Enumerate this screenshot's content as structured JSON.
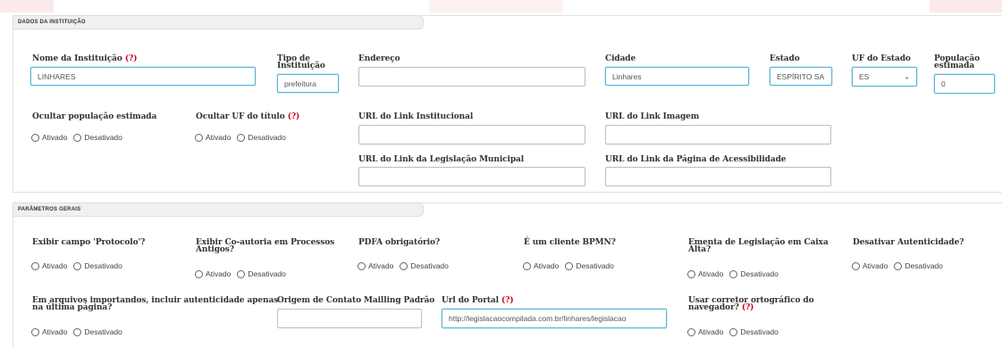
{
  "sections": {
    "institution": {
      "title": "DADOS DA INSTITUIÇÃO",
      "fields": {
        "nome": {
          "label": "Nome da Instituição",
          "help": "(?)",
          "value": "LINHARES"
        },
        "tipo": {
          "label_line1": "Tipo de",
          "label_line2": "Instituição",
          "value": "prefeitura"
        },
        "endereco": {
          "label": "Endereço",
          "value": ""
        },
        "cidade": {
          "label": "Cidade",
          "value": "Linhares"
        },
        "estado": {
          "label": "Estado",
          "value": "ESPÍRITO SA"
        },
        "uf": {
          "label": "UF do Estado",
          "value": "ES"
        },
        "populacao": {
          "label_line1": "População",
          "label_line2": "estimada",
          "value": "0"
        },
        "ocultar_pop": {
          "label": "Ocultar população estimada"
        },
        "ocultar_uf": {
          "label": "Ocultar UF do título",
          "help": "(?)"
        },
        "url_inst": {
          "label": "URL do Link Institucional",
          "value": ""
        },
        "url_img": {
          "label": "URL do Link Imagem",
          "value": ""
        },
        "url_leg": {
          "label": "URL do Link da Legislação Municipal",
          "value": ""
        },
        "url_acess": {
          "label": "URL do Link da Página de Acessibilidade",
          "value": ""
        }
      }
    },
    "general": {
      "title": "PARÂMETROS GERAIS",
      "fields": {
        "protocolo": {
          "label": "Exibir campo 'Protocolo'?"
        },
        "coautoria": {
          "label_line1": "Exibir Co-autoria em Processos",
          "label_line2": "Antigos?"
        },
        "pdfa": {
          "label": "PDFA obrigatório?"
        },
        "bpmn": {
          "label": "É um cliente BPMN?"
        },
        "ementa": {
          "label_line1": "Ementa de Legislação em Caixa",
          "label_line2": "Alta?"
        },
        "autenticidade": {
          "label": "Desativar Autenticidade?"
        },
        "arquivos": {
          "label_line1": "Em arquivos importandos, incluir autenticidade apenas",
          "label_line2": "na última página?"
        },
        "origem": {
          "label": "Origem de Contato Mailling Padrão",
          "value": ""
        },
        "portal": {
          "label": "Url do Portal",
          "help": "(?)",
          "value": "http://legislacaocompilada.com.br/linhares/legislacao"
        },
        "corretor": {
          "label_line1": "Usar corretor ortográfico do",
          "label_line2": "navegador?",
          "help": "(?)"
        }
      }
    }
  },
  "radio": {
    "on": "Ativado",
    "off": "Desativado"
  },
  "icons": {
    "select": "chevron-down-icon"
  },
  "colors": {
    "help": "#d0021b",
    "focus_border": "#5ab4d8"
  }
}
